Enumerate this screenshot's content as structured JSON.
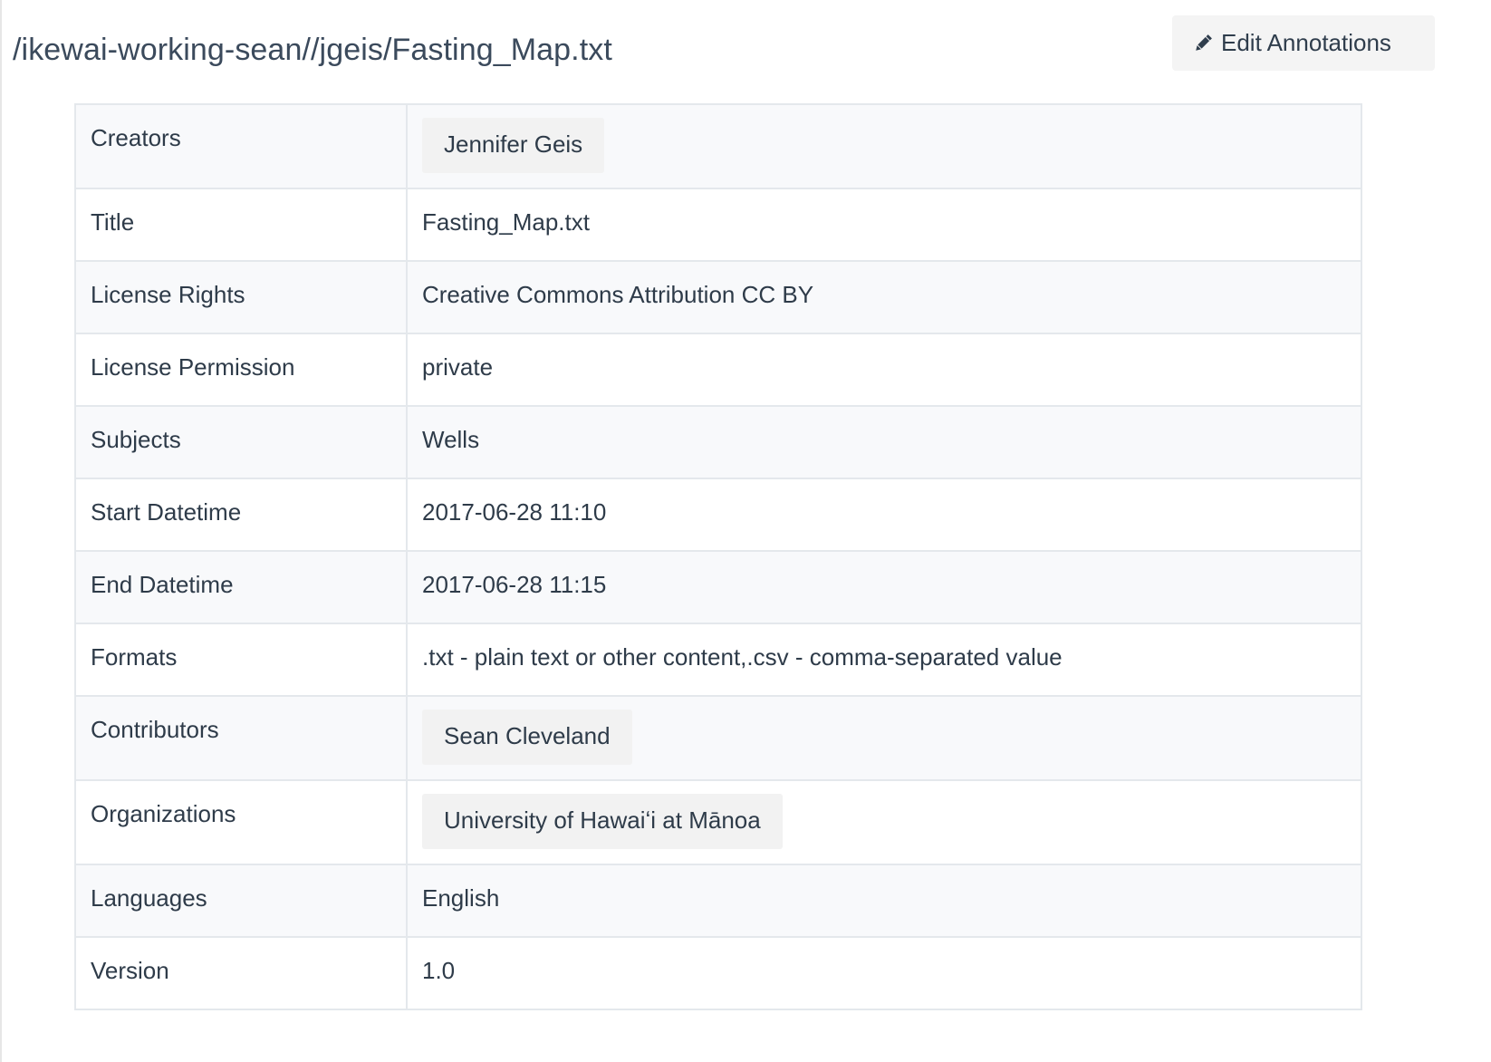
{
  "header": {
    "file_path": "/ikewai-working-sean//jgeis/Fasting_Map.txt",
    "edit_button_label": "Edit Annotations",
    "edit_button_icon": "pencil-icon"
  },
  "metadata": {
    "rows": [
      {
        "label": "Creators",
        "value": "Jennifer Geis",
        "chip": true
      },
      {
        "label": "Title",
        "value": "Fasting_Map.txt",
        "chip": false
      },
      {
        "label": "License Rights",
        "value": "Creative Commons Attribution CC BY",
        "chip": false
      },
      {
        "label": "License Permission",
        "value": "private",
        "chip": false
      },
      {
        "label": "Subjects",
        "value": "Wells",
        "chip": false
      },
      {
        "label": "Start Datetime",
        "value": "2017-06-28 11:10",
        "chip": false
      },
      {
        "label": "End Datetime",
        "value": "2017-06-28 11:15",
        "chip": false
      },
      {
        "label": "Formats",
        "value": ".txt - plain text or other content,.csv - comma-separated value",
        "chip": false
      },
      {
        "label": "Contributors",
        "value": "Sean Cleveland",
        "chip": true
      },
      {
        "label": "Organizations",
        "value": "University of Hawaiʻi at Mānoa",
        "chip": true
      },
      {
        "label": "Languages",
        "value": "English",
        "chip": false
      },
      {
        "label": "Version",
        "value": "1.0",
        "chip": false
      }
    ]
  }
}
